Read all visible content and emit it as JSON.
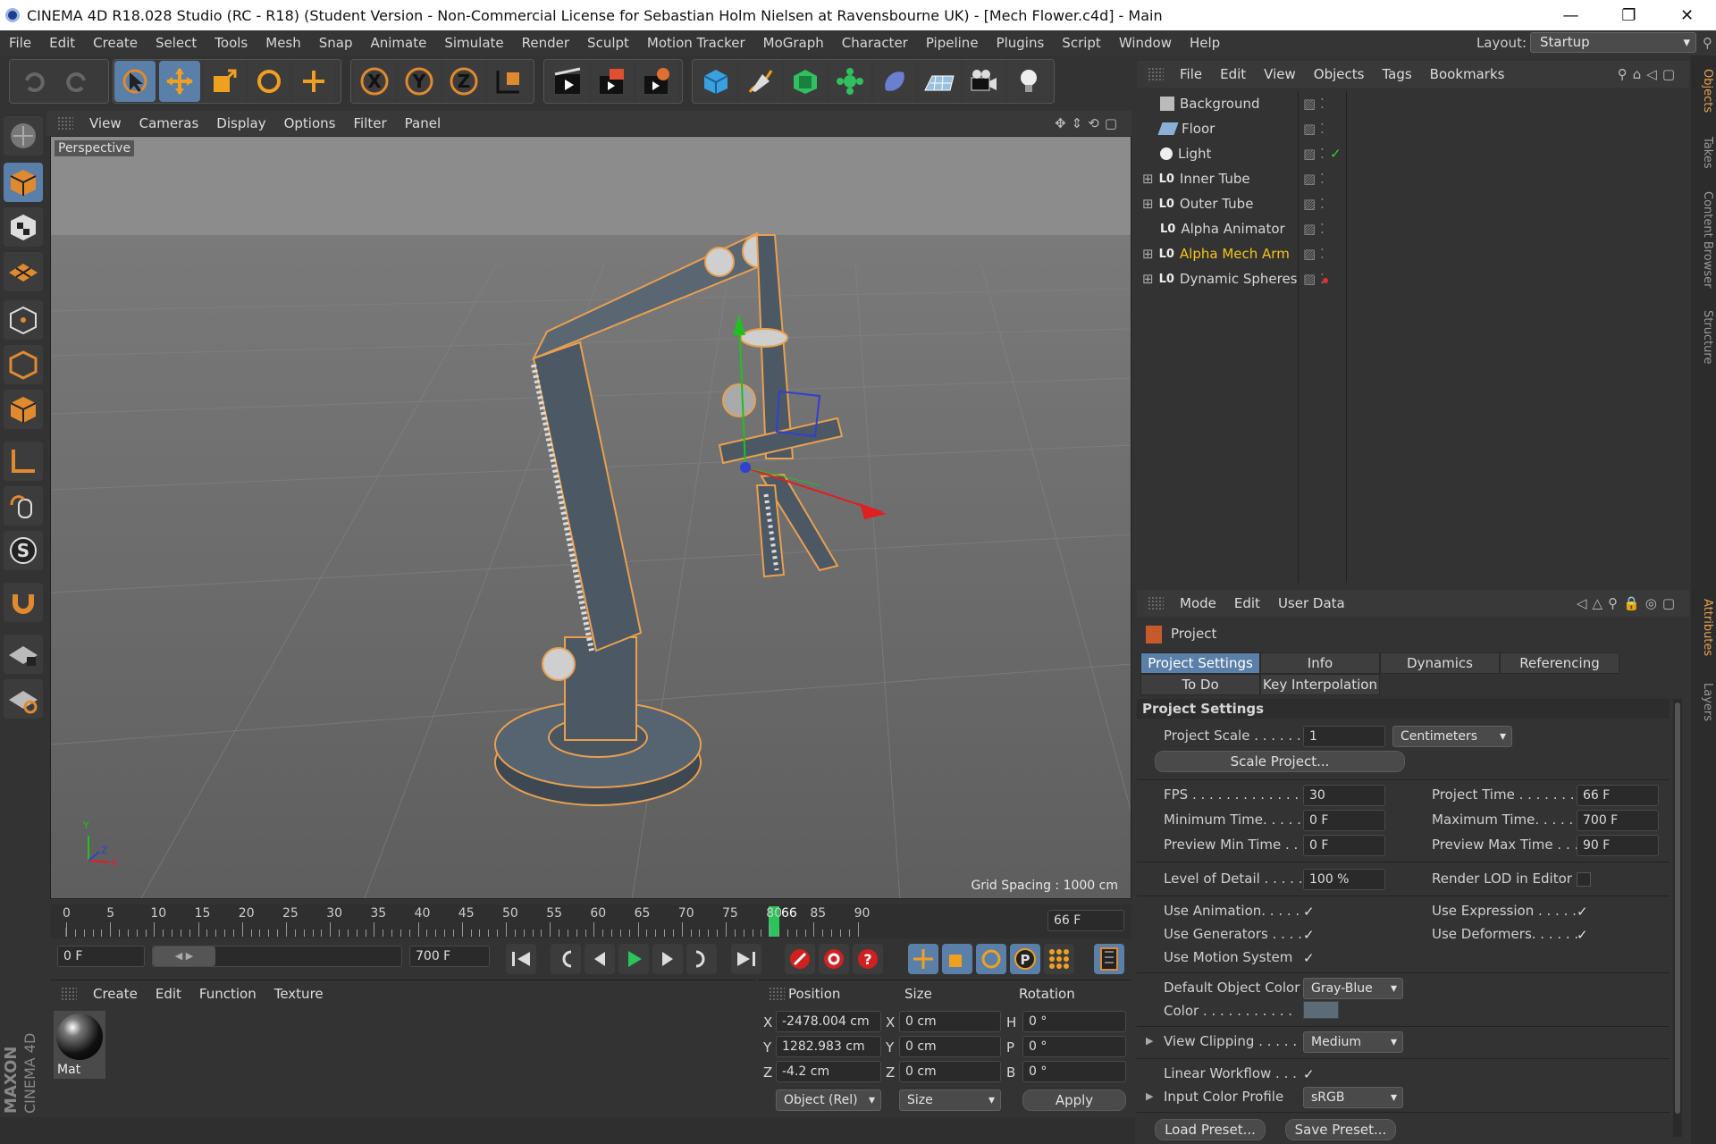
{
  "window": {
    "title": "CINEMA 4D R18.028 Studio (RC - R18) (Student Version - Non-Commercial License for Sebastian Holm Nielsen at Ravensbourne UK) - [Mech Flower.c4d] - Main"
  },
  "menu": [
    "File",
    "Edit",
    "Create",
    "Select",
    "Tools",
    "Mesh",
    "Snap",
    "Animate",
    "Simulate",
    "Render",
    "Sculpt",
    "Motion Tracker",
    "MoGraph",
    "Character",
    "Pipeline",
    "Plugins",
    "Script",
    "Window",
    "Help"
  ],
  "layout": {
    "label": "Layout:",
    "value": "Startup"
  },
  "viewport": {
    "menu": [
      "View",
      "Cameras",
      "Display",
      "Options",
      "Filter",
      "Panel"
    ],
    "label": "Perspective",
    "grid_spacing": "Grid Spacing : 1000 cm",
    "axis_labels": {
      "y": "Y",
      "x": "X",
      "z": "Z"
    }
  },
  "timeline": {
    "ticks": [
      "0",
      "5",
      "10",
      "15",
      "20",
      "25",
      "30",
      "35",
      "40",
      "45",
      "50",
      "55",
      "60",
      "65",
      "70",
      "75",
      "80",
      "85",
      "90"
    ],
    "current": "66",
    "current_field": "66 F",
    "start_field": "0 F",
    "end_field": "700 F"
  },
  "material_manager": {
    "menu": [
      "Create",
      "Edit",
      "Function",
      "Texture"
    ],
    "material_name": "Mat"
  },
  "coordinates": {
    "headers": [
      "Position",
      "Size",
      "Rotation"
    ],
    "rows": [
      {
        "axis": "X",
        "pos": "-2478.004 cm",
        "size_axis": "X",
        "size": "0 cm",
        "rot_axis": "H",
        "rot": "0 °"
      },
      {
        "axis": "Y",
        "pos": "1282.983 cm",
        "size_axis": "Y",
        "size": "0 cm",
        "rot_axis": "P",
        "rot": "0 °"
      },
      {
        "axis": "Z",
        "pos": "-4.2 cm",
        "size_axis": "Z",
        "size": "0 cm",
        "rot_axis": "B",
        "rot": "0 °"
      }
    ],
    "mode": "Object (Rel)",
    "size_mode": "Size",
    "apply": "Apply"
  },
  "objects": {
    "menu": [
      "File",
      "Edit",
      "View",
      "Objects",
      "Tags",
      "Bookmarks"
    ],
    "items": [
      {
        "name": "Background",
        "selected": false
      },
      {
        "name": "Floor",
        "selected": false
      },
      {
        "name": "Light",
        "selected": false
      },
      {
        "name": "Inner Tube",
        "selected": false
      },
      {
        "name": "Outer Tube",
        "selected": false
      },
      {
        "name": "Alpha Animator",
        "selected": false
      },
      {
        "name": "Alpha Mech Arm",
        "selected": true
      },
      {
        "name": "Dynamic Spheres",
        "selected": false
      }
    ]
  },
  "attributes": {
    "menu": [
      "Mode",
      "Edit",
      "User Data"
    ],
    "object": "Project",
    "tabs_row1": [
      "Project Settings",
      "Info",
      "Dynamics",
      "Referencing"
    ],
    "tabs_row2": [
      "To Do",
      "Key Interpolation"
    ],
    "section": "Project Settings",
    "project_scale_label": "Project Scale . . . . . .",
    "project_scale": "1",
    "project_scale_unit": "Centimeters",
    "scale_project_button": "Scale Project...",
    "fps_label": "FPS . . . . . . . . . . . . . . .",
    "fps": "30",
    "project_time_label": "Project Time . . . . . . . .",
    "project_time": "66 F",
    "min_time_label": "Minimum Time. . . . .",
    "min_time": "0 F",
    "max_time_label": "Maximum Time. . . . . .",
    "max_time": "700 F",
    "prev_min_label": "Preview Min Time . .",
    "prev_min": "0 F",
    "prev_max_label": "Preview Max Time . . .",
    "prev_max": "90 F",
    "lod_label": "Level of Detail . . . . .",
    "lod": "100 %",
    "render_lod_label": "Render LOD in Editor",
    "use_animation": "Use Animation. . . . .",
    "use_expression": "Use Expression . . . . .",
    "use_generators": "Use Generators . . . .",
    "use_deformers": "Use Deformers. . . . . .",
    "use_motion": "Use Motion System",
    "default_color_label": "Default Object Color",
    "default_color": "Gray-Blue",
    "color_label": "Color . . . . . . . . . . .",
    "view_clipping_label": "View Clipping . . . . .",
    "view_clipping": "Medium",
    "linear_workflow": "Linear Workflow . . .",
    "input_color_profile_label": "Input Color Profile",
    "input_color_profile": "sRGB",
    "load_preset": "Load Preset...",
    "save_preset": "Save Preset..."
  },
  "right_tabs": [
    "Objects",
    "Takes",
    "Content Browser",
    "Structure",
    "Attributes",
    "Layers"
  ],
  "brand": {
    "maxon": "MAXON",
    "product": "CINEMA 4D"
  },
  "colors": {
    "accent": "#5a7fa8",
    "selected_object": "#f5c518",
    "highlight": "#e8a050"
  }
}
